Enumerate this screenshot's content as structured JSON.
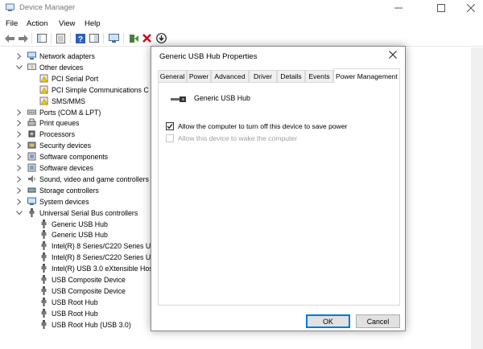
{
  "window": {
    "title": "Device Manager"
  },
  "menu": [
    "File",
    "Action",
    "View",
    "Help"
  ],
  "tree": [
    {
      "label": "Network adapters",
      "icon": "network-icon",
      "level": 1,
      "expander": "right"
    },
    {
      "label": "Other devices",
      "icon": "other-devices-icon",
      "level": 1,
      "expander": "down"
    },
    {
      "label": "PCI Serial Port",
      "icon": "unknown-device-icon",
      "level": 2,
      "expander": ""
    },
    {
      "label": "PCI Simple Communications C",
      "icon": "unknown-device-icon",
      "level": 2,
      "expander": ""
    },
    {
      "label": "SMS/MMS",
      "icon": "unknown-device-icon",
      "level": 2,
      "expander": ""
    },
    {
      "label": "Ports (COM & LPT)",
      "icon": "port-icon",
      "level": 1,
      "expander": "right"
    },
    {
      "label": "Print queues",
      "icon": "printer-icon",
      "level": 1,
      "expander": "right"
    },
    {
      "label": "Processors",
      "icon": "processor-icon",
      "level": 1,
      "expander": "right"
    },
    {
      "label": "Security devices",
      "icon": "security-icon",
      "level": 1,
      "expander": "right"
    },
    {
      "label": "Software components",
      "icon": "software-icon",
      "level": 1,
      "expander": "right"
    },
    {
      "label": "Software devices",
      "icon": "software-icon",
      "level": 1,
      "expander": "right"
    },
    {
      "label": "Sound, video and game controllers",
      "icon": "sound-icon",
      "level": 1,
      "expander": "right"
    },
    {
      "label": "Storage controllers",
      "icon": "storage-icon",
      "level": 1,
      "expander": "right"
    },
    {
      "label": "System devices",
      "icon": "system-icon",
      "level": 1,
      "expander": "right"
    },
    {
      "label": "Universal Serial Bus controllers",
      "icon": "usb-icon",
      "level": 1,
      "expander": "down"
    },
    {
      "label": "Generic USB Hub",
      "icon": "usb-icon",
      "level": 2,
      "expander": ""
    },
    {
      "label": "Generic USB Hub",
      "icon": "usb-icon",
      "level": 2,
      "expander": ""
    },
    {
      "label": "Intel(R) 8 Series/C220 Series US",
      "icon": "usb-icon",
      "level": 2,
      "expander": ""
    },
    {
      "label": "Intel(R) 8 Series/C220 Series US",
      "icon": "usb-icon",
      "level": 2,
      "expander": ""
    },
    {
      "label": "Intel(R) USB 3.0 eXtensible Hos",
      "icon": "usb-icon",
      "level": 2,
      "expander": ""
    },
    {
      "label": "USB Composite Device",
      "icon": "usb-icon",
      "level": 2,
      "expander": ""
    },
    {
      "label": "USB Composite Device",
      "icon": "usb-icon",
      "level": 2,
      "expander": ""
    },
    {
      "label": "USB Root Hub",
      "icon": "usb-icon",
      "level": 2,
      "expander": ""
    },
    {
      "label": "USB Root Hub",
      "icon": "usb-icon",
      "level": 2,
      "expander": ""
    },
    {
      "label": "USB Root Hub (USB 3.0)",
      "icon": "usb-icon",
      "level": 2,
      "expander": ""
    }
  ],
  "dialog": {
    "title": "Generic USB Hub Properties",
    "tabs": [
      "General",
      "Power",
      "Advanced",
      "Driver",
      "Details",
      "Events",
      "Power Management"
    ],
    "active_tab": "Power Management",
    "device_name": "Generic USB Hub",
    "options": [
      {
        "label": "Allow the computer to turn off this device to save power",
        "checked": true,
        "enabled": true
      },
      {
        "label": "Allow this device to wake the computer",
        "checked": false,
        "enabled": false
      }
    ],
    "ok_label": "OK",
    "cancel_label": "Cancel"
  },
  "colors": {
    "accent": "#0078d7",
    "disabled_text": "#a0a0a0"
  }
}
